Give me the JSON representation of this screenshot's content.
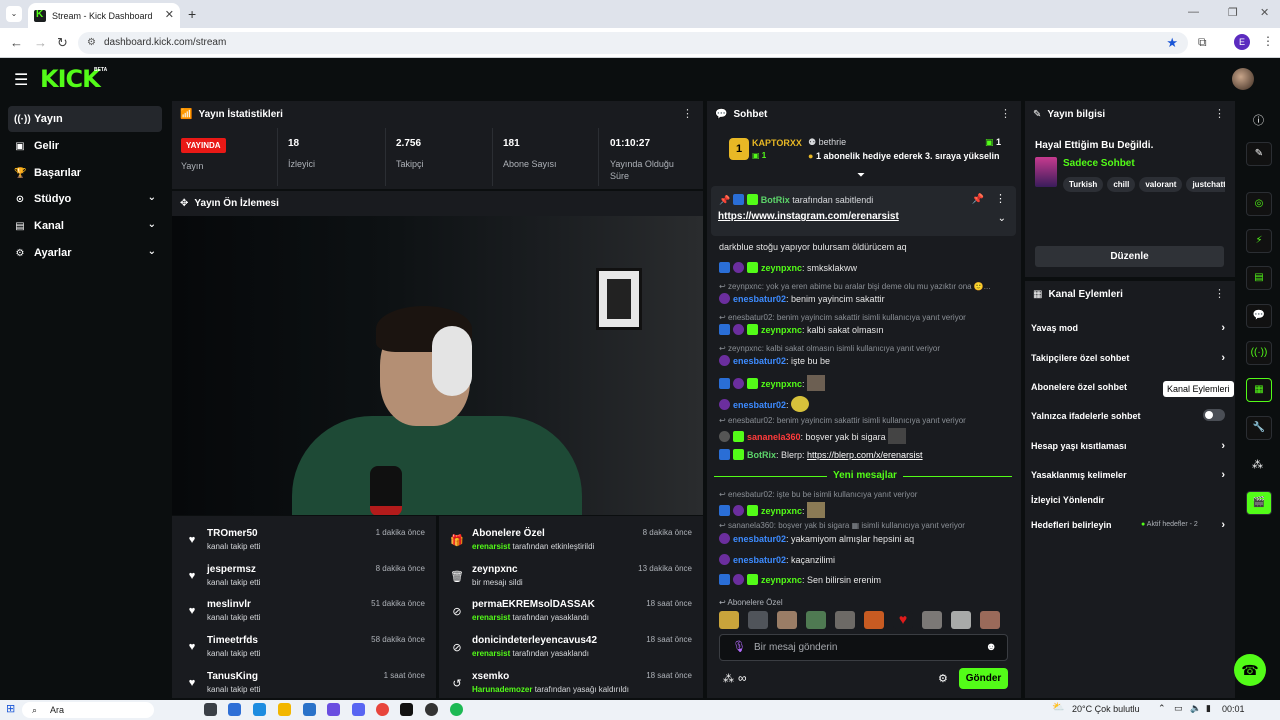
{
  "browser": {
    "tab_title": "Stream - Kick Dashboard",
    "url": "dashboard.kick.com/stream",
    "profile_initial": "E"
  },
  "header": {
    "logo": "KICK",
    "beta": "BETA"
  },
  "sidebar": {
    "items": [
      {
        "label": "Yayın",
        "icon": "broadcast-icon",
        "active": true
      },
      {
        "label": "Gelir",
        "icon": "revenue-icon"
      },
      {
        "label": "Başarılar",
        "icon": "trophy-icon"
      },
      {
        "label": "Stüdyo",
        "icon": "studio-icon",
        "expandable": true
      },
      {
        "label": "Kanal",
        "icon": "channel-icon",
        "expandable": true
      },
      {
        "label": "Ayarlar",
        "icon": "settings-icon",
        "expandable": true
      }
    ]
  },
  "stats": {
    "title": "Yayın İstatistikleri",
    "live_badge": "YAYINDA",
    "live_label": "Yayın",
    "viewers": "18",
    "viewers_label": "İzleyici",
    "followers": "2.756",
    "followers_label": "Takipçi",
    "subs": "181",
    "subs_label": "Abone Sayısı",
    "uptime": "01:10:27",
    "uptime_label_1": "Yayında Olduğu",
    "uptime_label_2": "Süre"
  },
  "preview": {
    "title": "Yayın Ön İzlemesi"
  },
  "follows": [
    {
      "name": "TROmer50",
      "sub": "kanalı takip etti",
      "time": "1 dakika önce"
    },
    {
      "name": "jespermsz",
      "sub": "kanalı takip etti",
      "time": "8 dakika önce"
    },
    {
      "name": "meslinvlr",
      "sub": "kanalı takip etti",
      "time": "51 dakika önce"
    },
    {
      "name": "Timeetrfds",
      "sub": "kanalı takip etti",
      "time": "58 dakika önce"
    },
    {
      "name": "TanusKing",
      "sub": "kanalı takip etti",
      "time": "1 saat önce"
    }
  ],
  "mod_actions": [
    {
      "name": "Abonelere Özel",
      "actor": "erenarsist",
      "sub": " tarafından etkinleştirildi",
      "time": "8 dakika önce",
      "icon": "gift-icon"
    },
    {
      "name": "zeynpxnc",
      "actor": "",
      "sub": "bir mesajı sildi",
      "time": "13 dakika önce",
      "icon": "trash-icon"
    },
    {
      "name": "permaEKREMsolDASSAK",
      "actor": "erenarsist",
      "sub": " tarafından yasaklandı",
      "time": "18 saat önce",
      "icon": "ban-icon"
    },
    {
      "name": "donicindeterleyencavus42",
      "actor": "erenarsist",
      "sub": " tarafından yasaklandı",
      "time": "18 saat önce",
      "icon": "ban-icon"
    },
    {
      "name": "xsemko",
      "actor": "Harunademozer",
      "sub": " tarafından yasağı kaldırıldı",
      "time": "18 saat önce",
      "icon": "undo-icon"
    }
  ],
  "chat": {
    "title": "Sohbet",
    "top_gifter": {
      "name": "KAPTORXX",
      "count": "1",
      "rank": "1"
    },
    "gift_event": {
      "name": "bethrie",
      "count": "1",
      "text": "1 abonelik hediye ederek 3. sıraya yükselin"
    },
    "pinned": {
      "author": "BotRix",
      "note": " tarafından sabitlendi",
      "link": "https://www.instagram.com/erenarsist"
    },
    "messages": [
      {
        "type": "plain",
        "text": "darkblue stoğu yapıyor bulursam öldürücem aq"
      },
      {
        "type": "msg",
        "user": "zeynpxnc",
        "color": "g",
        "text": ": smksklakww"
      },
      {
        "type": "reply",
        "text": "zeynpxnc: yok ya eren abime bu aralar bişi deme olu mu yazıktır ona 🙂..."
      },
      {
        "type": "msg",
        "user": "enesbatur02",
        "color": "b",
        "text": ": benim yayincim sakattir"
      },
      {
        "type": "reply",
        "text": "enesbatur02: benim yayincim sakattir isimli kullanıcıya yanıt veriyor"
      },
      {
        "type": "msg",
        "user": "zeynpxnc",
        "color": "g",
        "text": ": kalbi sakat olmasın"
      },
      {
        "type": "reply",
        "text": "zeynpxnc: kalbi sakat olmasın isimli kullanıcıya yanıt veriyor"
      },
      {
        "type": "msg",
        "user": "enesbatur02",
        "color": "b",
        "text": ": işte bu be"
      },
      {
        "type": "msg",
        "user": "zeynpxnc",
        "color": "g",
        "text": ":"
      },
      {
        "type": "msg",
        "user": "enesbatur02",
        "color": "b",
        "text": ":"
      },
      {
        "type": "reply",
        "text": "enesbatur02: benim yayincim sakattir isimli kullanıcıya yanıt veriyor"
      },
      {
        "type": "msg",
        "user": "sananela360",
        "color": "r",
        "text": ": boşver yak bi sigara"
      },
      {
        "type": "msg",
        "user": "BotRix",
        "color": "gr",
        "text": ": Blerp: ",
        "link": "https://blerp.com/x/erenarsist"
      }
    ],
    "new_messages_label": "Yeni mesajlar",
    "new_messages": [
      {
        "type": "reply",
        "text": "enesbatur02: işte bu be isimli kullanıcıya yanıt veriyor"
      },
      {
        "type": "msg",
        "user": "zeynpxnc",
        "color": "g",
        "text": ":"
      },
      {
        "type": "reply",
        "text": "sananela360: boşver yak bi sigara ▦ isimli kullanıcıya yanıt veriyor"
      },
      {
        "type": "msg",
        "user": "enesbatur02",
        "color": "b",
        "text": ": yakamiyom almışlar hepsini aq"
      },
      {
        "type": "msg",
        "user": "enesbatur02",
        "color": "b",
        "text": ": kaçanzilimi"
      },
      {
        "type": "msg",
        "user": "zeynpxnc",
        "color": "g",
        "text": ": Sen bilirsin erenim"
      }
    ],
    "emote_section": "Abonelere Özel",
    "input_placeholder": "Bir mesaj gönderin",
    "send_label": "Gönder"
  },
  "stream_info": {
    "title": "Yayın bilgisi",
    "stream_title": "Hayal Ettiğim Bu Değildi.",
    "category": "Sadece Sohbet",
    "tags": [
      "Turkish",
      "chill",
      "valorant",
      "justchatt"
    ],
    "edit_label": "Düzenle"
  },
  "channel_actions": {
    "title": "Kanal Eylemleri",
    "items": [
      {
        "label": "Yavaş mod",
        "kind": "arrow"
      },
      {
        "label": "Takipçilere özel sohbet",
        "kind": "arrow"
      },
      {
        "label": "Abonelere özel sohbet",
        "kind": "none"
      },
      {
        "label": "Yalnızca ifadelerle sohbet",
        "kind": "toggle"
      },
      {
        "label": "Hesap yaşı kısıtlaması",
        "kind": "arrow"
      },
      {
        "label": "Yasaklanmış kelimeler",
        "kind": "arrow"
      },
      {
        "label": "İzleyici Yönlendir",
        "kind": "none"
      },
      {
        "label": "Hedefleri belirleyin",
        "kind": "arrow",
        "extra": "Aktif hedefler - 2"
      }
    ],
    "tooltip": "Kanal Eylemleri"
  },
  "taskbar": {
    "search": "Ara",
    "weather": "20°C  Çok bulutlu",
    "clock": "00:01"
  },
  "colors": {
    "accent": "#53fc18",
    "panel": "#191b1f",
    "bg": "#0b0e0f",
    "live": "#e91916"
  }
}
